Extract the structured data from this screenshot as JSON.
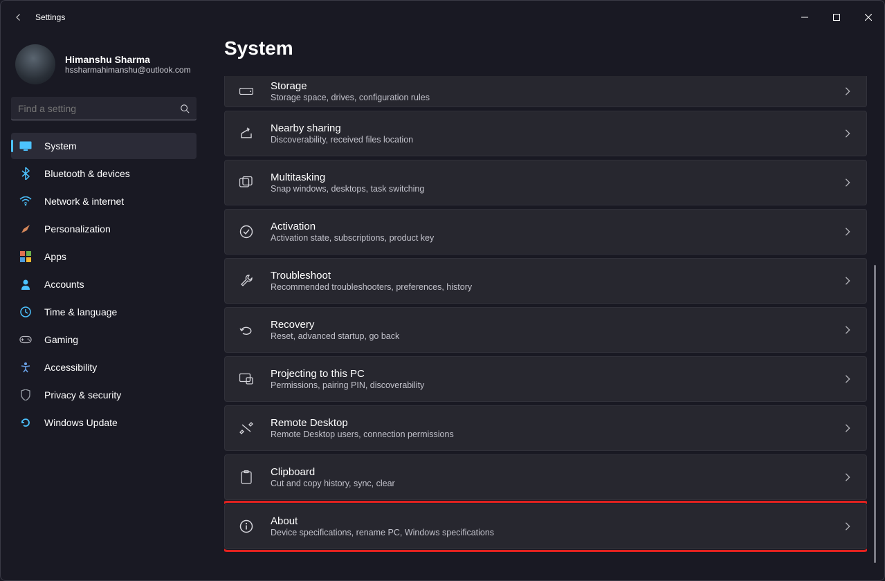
{
  "window": {
    "title": "Settings"
  },
  "profile": {
    "name": "Himanshu Sharma",
    "email": "hssharmahimanshu@outlook.com"
  },
  "search": {
    "placeholder": "Find a setting"
  },
  "nav": {
    "items": [
      {
        "label": "System",
        "selected": true
      },
      {
        "label": "Bluetooth & devices"
      },
      {
        "label": "Network & internet"
      },
      {
        "label": "Personalization"
      },
      {
        "label": "Apps"
      },
      {
        "label": "Accounts"
      },
      {
        "label": "Time & language"
      },
      {
        "label": "Gaming"
      },
      {
        "label": "Accessibility"
      },
      {
        "label": "Privacy & security"
      },
      {
        "label": "Windows Update"
      }
    ]
  },
  "page": {
    "title": "System"
  },
  "items": [
    {
      "title": "Storage",
      "sub": "Storage space, drives, configuration rules",
      "icon": "storage-icon",
      "cut_top": true
    },
    {
      "title": "Nearby sharing",
      "sub": "Discoverability, received files location",
      "icon": "share-icon"
    },
    {
      "title": "Multitasking",
      "sub": "Snap windows, desktops, task switching",
      "icon": "multitask-icon"
    },
    {
      "title": "Activation",
      "sub": "Activation state, subscriptions, product key",
      "icon": "check-circle-icon"
    },
    {
      "title": "Troubleshoot",
      "sub": "Recommended troubleshooters, preferences, history",
      "icon": "wrench-icon"
    },
    {
      "title": "Recovery",
      "sub": "Reset, advanced startup, go back",
      "icon": "recovery-icon"
    },
    {
      "title": "Projecting to this PC",
      "sub": "Permissions, pairing PIN, discoverability",
      "icon": "project-icon"
    },
    {
      "title": "Remote Desktop",
      "sub": "Remote Desktop users, connection permissions",
      "icon": "remote-icon"
    },
    {
      "title": "Clipboard",
      "sub": "Cut and copy history, sync, clear",
      "icon": "clipboard-icon"
    },
    {
      "title": "About",
      "sub": "Device specifications, rename PC, Windows specifications",
      "icon": "info-icon",
      "highlighted": true
    }
  ],
  "nav_icons": [
    "display-icon",
    "bluetooth-icon",
    "wifi-icon",
    "brush-icon",
    "apps-icon",
    "person-icon",
    "clock-icon",
    "gamepad-icon",
    "accessibility-icon",
    "shield-icon",
    "update-icon"
  ]
}
